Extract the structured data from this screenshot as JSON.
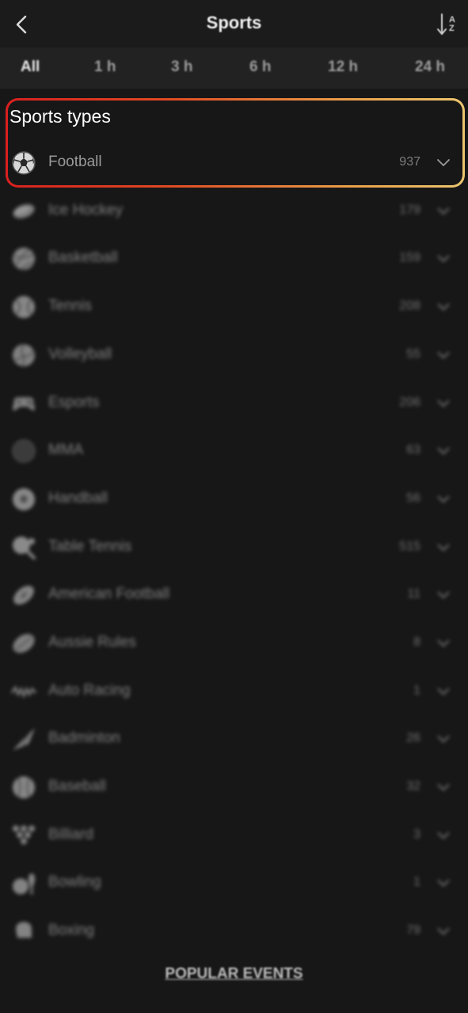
{
  "header": {
    "title": "Sports",
    "sort_top": "A",
    "sort_bottom": "Z"
  },
  "time_tabs": [
    {
      "label": "All",
      "active": true
    },
    {
      "label": "1 h"
    },
    {
      "label": "3 h"
    },
    {
      "label": "6 h"
    },
    {
      "label": "12 h"
    },
    {
      "label": "24 h"
    }
  ],
  "section": {
    "title": "Sports types"
  },
  "sports": [
    {
      "name": "Football",
      "count": "937",
      "icon": "football-icon"
    },
    {
      "name": "Ice Hockey",
      "count": "179",
      "icon": "ice-hockey-icon"
    },
    {
      "name": "Basketball",
      "count": "159",
      "icon": "basketball-icon"
    },
    {
      "name": "Tennis",
      "count": "208",
      "icon": "tennis-icon"
    },
    {
      "name": "Volleyball",
      "count": "55",
      "icon": "volleyball-icon"
    },
    {
      "name": "Esports",
      "count": "206",
      "icon": "gamepad-icon"
    },
    {
      "name": "MMA",
      "count": "63",
      "icon": "mma-icon"
    },
    {
      "name": "Handball",
      "count": "56",
      "icon": "handball-icon"
    },
    {
      "name": "Table Tennis",
      "count": "515",
      "icon": "table-tennis-icon"
    },
    {
      "name": "American Football",
      "count": "11",
      "icon": "american-football-icon"
    },
    {
      "name": "Aussie Rules",
      "count": "8",
      "icon": "aussie-rules-icon"
    },
    {
      "name": "Auto Racing",
      "count": "1",
      "icon": "auto-racing-icon"
    },
    {
      "name": "Badminton",
      "count": "26",
      "icon": "badminton-icon"
    },
    {
      "name": "Baseball",
      "count": "32",
      "icon": "baseball-icon"
    },
    {
      "name": "Billiard",
      "count": "3",
      "icon": "billiard-icon"
    },
    {
      "name": "Bowling",
      "count": "1",
      "icon": "bowling-icon"
    },
    {
      "name": "Boxing",
      "count": "79",
      "icon": "boxing-icon"
    }
  ],
  "footer": {
    "popular_label": "POPULAR EVENTS"
  },
  "colors": {
    "background": "#181718",
    "highlight_start": "#d8201f",
    "highlight_end": "#ebc56e"
  }
}
